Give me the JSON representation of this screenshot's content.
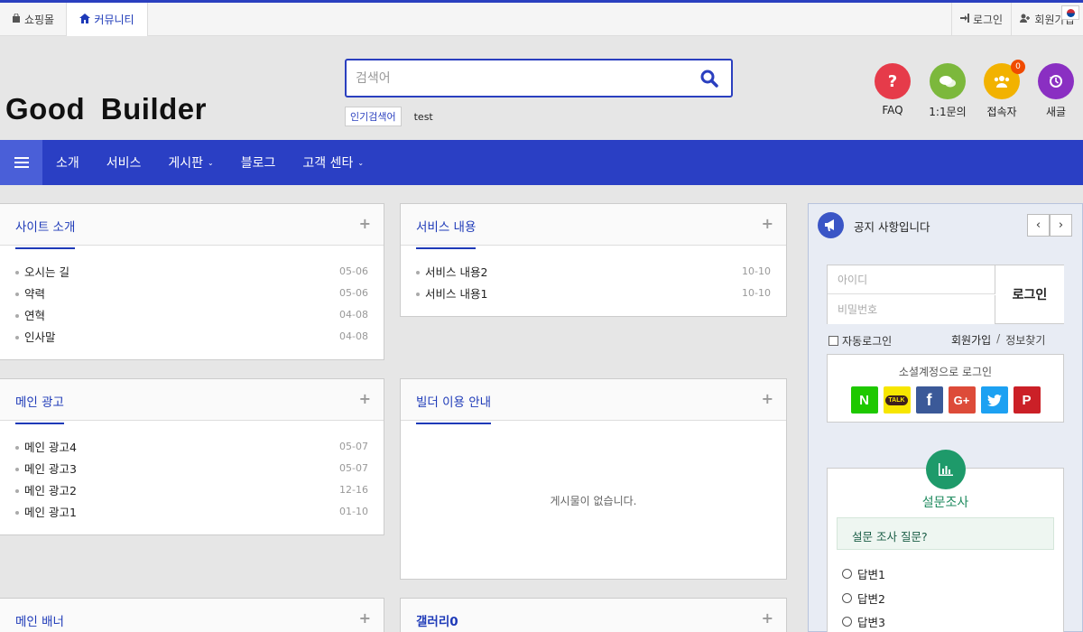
{
  "topbar": {
    "shop_label": "쇼핑몰",
    "community_label": "커뮤니티",
    "login_label": "로그인",
    "join_label": "회원가입"
  },
  "header": {
    "logo": "Good Builder",
    "search_placeholder": "검색어",
    "popular_tag": "인기검색어",
    "popular_keyword": "test",
    "quick": [
      {
        "label": "FAQ",
        "icon": "question-icon",
        "color": "#e63b4a"
      },
      {
        "label": "1:1문의",
        "icon": "chat-icon",
        "color": "#7cb83c"
      },
      {
        "label": "접속자",
        "icon": "users-icon",
        "color": "#f2b200",
        "badge": "0"
      },
      {
        "label": "새글",
        "icon": "history-icon",
        "color": "#8a2fc2"
      }
    ]
  },
  "nav": {
    "items": [
      {
        "label": "소개"
      },
      {
        "label": "서비스"
      },
      {
        "label": "게시판",
        "dropdown": true
      },
      {
        "label": "블로그"
      },
      {
        "label": "고객 센타",
        "dropdown": true
      }
    ]
  },
  "boxes": {
    "intro": {
      "title": "사이트 소개",
      "items": [
        {
          "title": "오시는 길",
          "date": "05-06"
        },
        {
          "title": "약력",
          "date": "05-06"
        },
        {
          "title": "연혁",
          "date": "04-08"
        },
        {
          "title": "인사말",
          "date": "04-08"
        }
      ]
    },
    "service": {
      "title": "서비스 내용",
      "items": [
        {
          "title": "서비스 내용2",
          "date": "10-10"
        },
        {
          "title": "서비스 내용1",
          "date": "10-10"
        }
      ]
    },
    "ad": {
      "title": "메인 광고",
      "items": [
        {
          "title": "메인 광고4",
          "date": "05-07"
        },
        {
          "title": "메인 광고3",
          "date": "05-07"
        },
        {
          "title": "메인 광고2",
          "date": "12-16"
        },
        {
          "title": "메인 광고1",
          "date": "01-10"
        }
      ]
    },
    "guide": {
      "title": "빌더 이용 안내",
      "empty": "게시물이 없습니다."
    },
    "banner": {
      "title": "메인 배너"
    },
    "gallery": {
      "title": "갤러리0"
    }
  },
  "sidebar": {
    "notice": "공지 사항입니다",
    "prev": "‹",
    "next": "›",
    "login": {
      "id_placeholder": "아이디",
      "pw_placeholder": "비밀번호",
      "button": "로그인",
      "auto_login": "자동로그인",
      "join": "회원가입",
      "separator": "/",
      "find": "정보찾기"
    },
    "social": {
      "title": "소셜계정으로 로그인",
      "providers": [
        {
          "name": "naver-icon",
          "glyph": "N",
          "color": "#1ec800",
          "text": "#fff"
        },
        {
          "name": "kakao-icon",
          "glyph": "TALK",
          "color": "#f7e600",
          "text": "#3c1e1e"
        },
        {
          "name": "facebook-icon",
          "glyph": "f",
          "color": "#3b5998",
          "text": "#fff"
        },
        {
          "name": "google-plus-icon",
          "glyph": "G+",
          "color": "#dd4b39",
          "text": "#fff"
        },
        {
          "name": "twitter-icon",
          "glyph": "t",
          "color": "#1da1f2",
          "text": "#fff"
        },
        {
          "name": "pinterest-icon",
          "glyph": "P",
          "color": "#cb2027",
          "text": "#fff"
        }
      ]
    },
    "poll": {
      "title": "설문조사",
      "question": "설문 조사 질문?",
      "options": [
        "답변1",
        "답변2",
        "답변3"
      ]
    }
  },
  "colors": {
    "primary": "#2a3fc4",
    "accent_blue": "#1e3ab8",
    "poll_green": "#1e9a6a"
  }
}
